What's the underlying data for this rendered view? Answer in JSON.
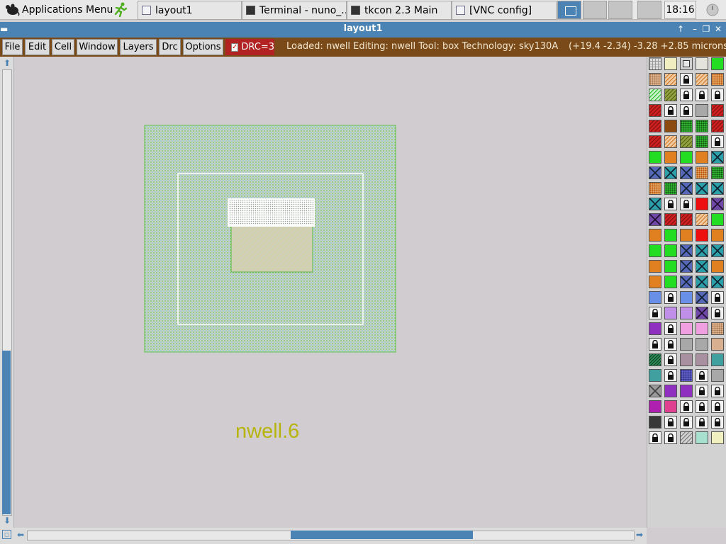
{
  "taskbar": {
    "apps_menu_label": "Applications Menu",
    "tasks": [
      "layout1",
      "Terminal - nuno_...",
      "tkcon 2.3 Main",
      "[VNC config]"
    ],
    "clock": "18:16"
  },
  "window": {
    "title": "layout1",
    "controls": [
      "↑",
      "–",
      "❐",
      "✕"
    ]
  },
  "menubar": {
    "items": [
      "File",
      "Edit",
      "Cell",
      "Window",
      "Layers",
      "Drc",
      "Options"
    ],
    "drc_label": "DRC=3",
    "drc_checked": true,
    "status": "Loaded: nwell Editing: nwell Tool: box  Technology: sky130A",
    "coords": "(+19.4 -2.34) -3.28 +2.85 microns"
  },
  "layout": {
    "drc_rule_label": "nwell.6"
  },
  "colors": {
    "titlebar": "#4a83b4",
    "menubar": "#7a4a18",
    "drc_badge": "#b22222",
    "canvas_bg": "#d0ccd0",
    "nwell_green": "#7ccc66",
    "label_yellow": "#b8b40e"
  },
  "palette": {
    "rows": [
      [
        "grid",
        "yellow",
        "box",
        "light",
        "green"
      ],
      [
        "tan-dot",
        "orange-hatch",
        "lock",
        "orange-hatch",
        "orange-dot"
      ],
      [
        "green-hatch",
        "olive-hatch",
        "lock",
        "lock",
        "lock"
      ],
      [
        "red-hatch",
        "lock",
        "lock",
        "gray",
        "red-hatch"
      ],
      [
        "red-hatch",
        "brown",
        "green-dot",
        "green-dot",
        "red-hatch"
      ],
      [
        "red-hatch",
        "orange-hatch",
        "olive-hatch",
        "green-dot",
        "lock"
      ],
      [
        "green",
        "orange",
        "green",
        "orange",
        "teal-x"
      ],
      [
        "blue-x",
        "teal-x",
        "blue-x",
        "orange-dot",
        "green-dot"
      ],
      [
        "orange-dot",
        "green-dot",
        "blue-x",
        "teal-x",
        "teal-x"
      ],
      [
        "teal-x",
        "lock",
        "lock",
        "red",
        "purple-x"
      ],
      [
        "purple-x",
        "red-hatch",
        "red-hatch",
        "orange-hatch",
        "green"
      ],
      [
        "orange",
        "green",
        "orange",
        "red",
        "orange"
      ],
      [
        "green",
        "green",
        "blue-x",
        "teal-x",
        "teal-x"
      ],
      [
        "orange",
        "green",
        "blue-x",
        "teal-x",
        "orange"
      ],
      [
        "orange",
        "green",
        "blue-x",
        "teal-x",
        "teal-x"
      ],
      [
        "blue",
        "lock",
        "blue",
        "blue-x",
        "lock"
      ],
      [
        "lock",
        "violet",
        "violet",
        "purple-x",
        "lock"
      ],
      [
        "purple",
        "lock",
        "pink",
        "pink",
        "tan-dot"
      ],
      [
        "lock",
        "lock",
        "gray",
        "gray",
        "tan"
      ],
      [
        "dkgreen",
        "lock",
        "mauve",
        "mauve",
        "teal"
      ],
      [
        "teal",
        "lock",
        "blue-dot",
        "lock",
        "gray"
      ],
      [
        "gray-x",
        "purple",
        "purple",
        "lock",
        "lock"
      ],
      [
        "magenta",
        "rose",
        "lock",
        "lock",
        "lock"
      ],
      [
        "dark",
        "lock",
        "lock",
        "lock",
        "lock"
      ],
      [
        "lock",
        "lock",
        "gray-hatch",
        "mint",
        "cream"
      ]
    ]
  }
}
